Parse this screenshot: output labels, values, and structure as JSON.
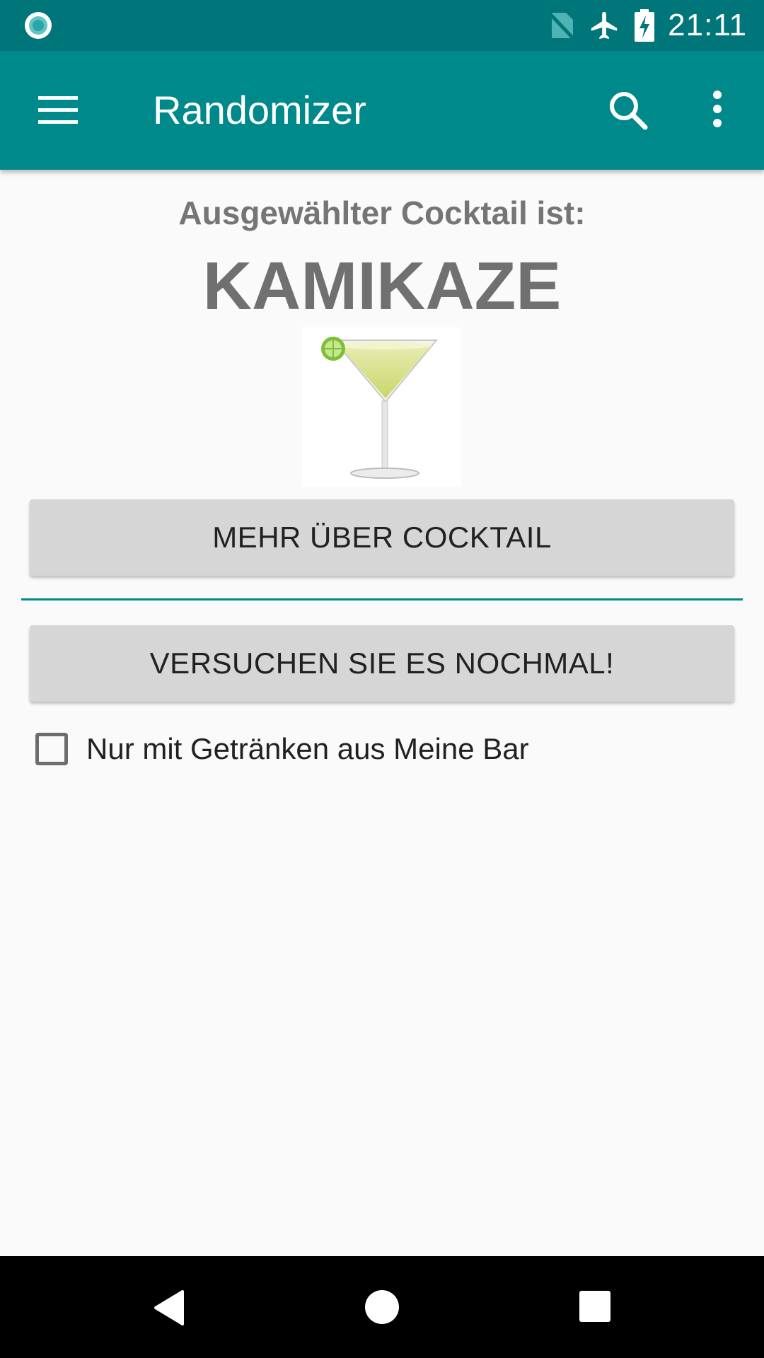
{
  "status_bar": {
    "time": "21:11",
    "icons": [
      "notification-circle-icon",
      "no-sim-icon",
      "airplane-mode-icon",
      "battery-charging-icon"
    ]
  },
  "app_bar": {
    "title": "Randomizer",
    "icons": [
      "menu-icon",
      "search-icon",
      "more-options-icon"
    ],
    "color": "#00898a"
  },
  "content": {
    "subtitle": "Ausgewählter Cocktail ist:",
    "cocktail_name": "KAMIKAZE",
    "image_icon": "martini-glass-icon",
    "more_button": "MEHR ÜBER COCKTAIL",
    "retry_button": "VERSUCHEN SIE ES NOCHMAL!",
    "checkbox_label": "Nur mit Getränken aus Meine Bar",
    "checkbox_checked": false
  },
  "nav_bar": {
    "icons": [
      "back-icon",
      "home-icon",
      "recent-apps-icon"
    ]
  },
  "colors": {
    "status_bar": "#00757a",
    "app_bar": "#00898a",
    "button": "#d6d6d6",
    "background": "#fafafa"
  }
}
